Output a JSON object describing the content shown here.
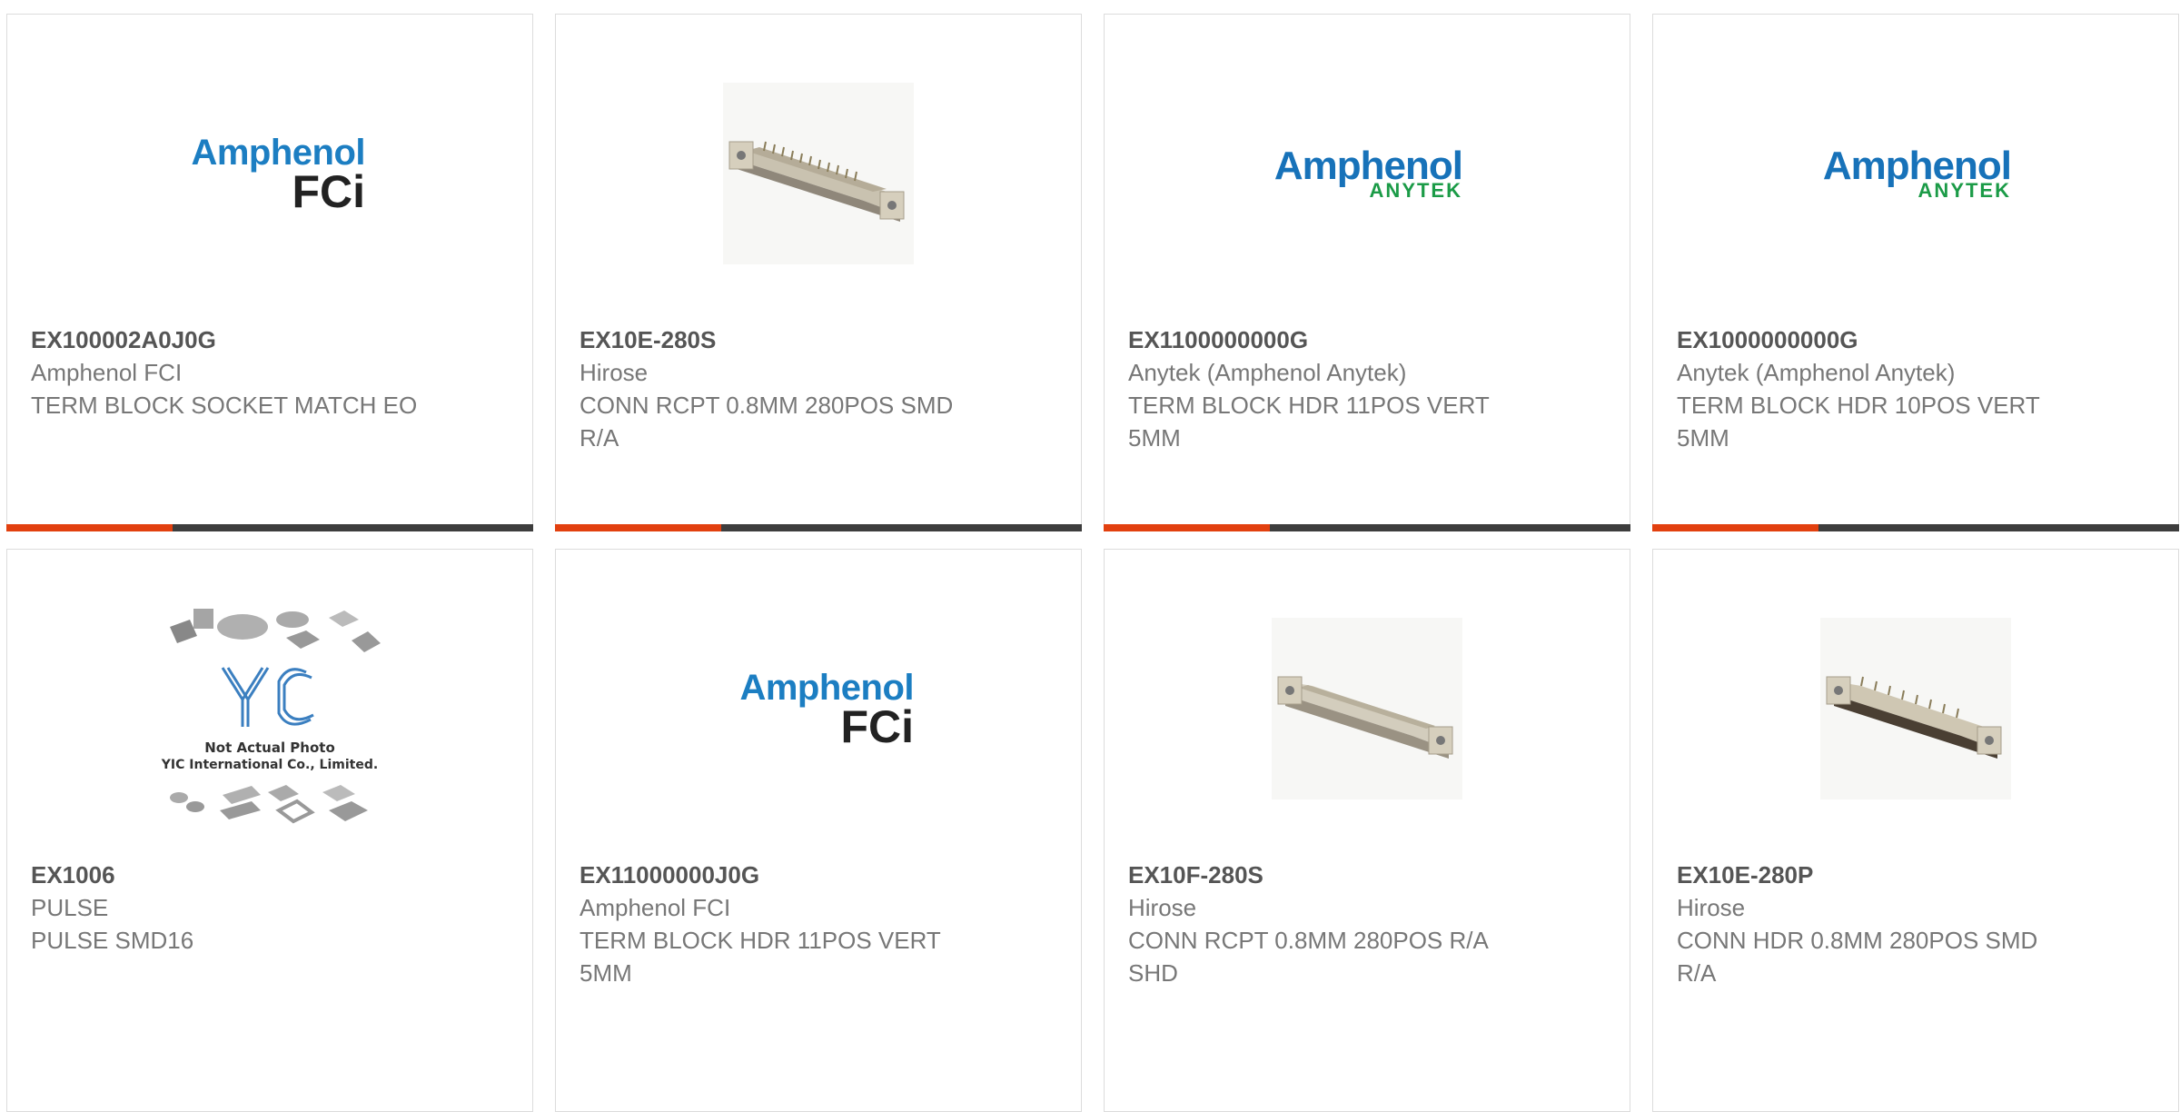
{
  "products": [
    {
      "part_number": "EX100002A0J0G",
      "manufacturer": "Amphenol FCI",
      "description": "TERM BLOCK SOCKET MATCH EO",
      "image": "logo-amphenol-fci",
      "logo_line1": "Amphenol",
      "logo_line2": "FCi"
    },
    {
      "part_number": "EX10E-280S",
      "manufacturer": "Hirose",
      "description": "CONN RCPT 0.8MM 280POS SMD R/A",
      "image": "connector-photo"
    },
    {
      "part_number": "EX1100000000G",
      "manufacturer": "Anytek (Amphenol Anytek)",
      "description": "TERM BLOCK HDR 11POS VERT 5MM",
      "image": "logo-amphenol-anytek",
      "logo_line1": "Amphenol",
      "logo_line2": "ANYTEK"
    },
    {
      "part_number": "EX1000000000G",
      "manufacturer": "Anytek (Amphenol Anytek)",
      "description": "TERM BLOCK HDR 10POS VERT 5MM",
      "image": "logo-amphenol-anytek",
      "logo_line1": "Amphenol",
      "logo_line2": "ANYTEK"
    },
    {
      "part_number": "EX1006",
      "manufacturer": "PULSE",
      "description": "PULSE SMD16",
      "image": "not-actual-photo",
      "placeholder_line1": "Not Actual Photo",
      "placeholder_line2": "YIC International Co., Limited."
    },
    {
      "part_number": "EX11000000J0G",
      "manufacturer": "Amphenol FCI",
      "description": "TERM BLOCK HDR 11POS VERT 5MM",
      "image": "logo-amphenol-fci",
      "logo_line1": "Amphenol",
      "logo_line2": "FCi"
    },
    {
      "part_number": "EX10F-280S",
      "manufacturer": "Hirose",
      "description": "CONN RCPT 0.8MM 280POS R/A SHD",
      "image": "connector-photo"
    },
    {
      "part_number": "EX10E-280P",
      "manufacturer": "Hirose",
      "description": "CONN HDR 0.8MM 280POS SMD R/A",
      "image": "connector-photo"
    }
  ],
  "colors": {
    "accent": "#e2400f",
    "bar": "#3d3d3d",
    "amphenol_blue": "#1c7ec2",
    "anytek_green": "#1b9b47"
  }
}
